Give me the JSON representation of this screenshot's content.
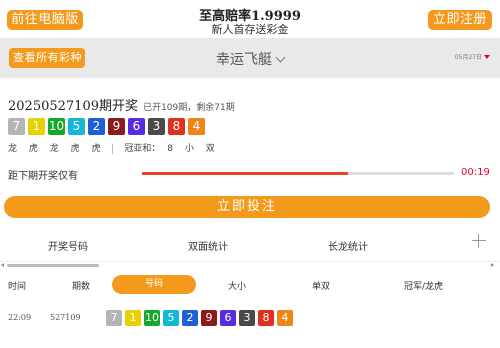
{
  "header": {
    "pc_button": "前往电脑版",
    "promo_title": "至高赔率1.9999",
    "promo_sub": "新人首存送彩金",
    "register_button": "立即注册"
  },
  "lottery_bar": {
    "all_button": "查看所有彩种",
    "name": "幸运飞艇",
    "date": "05月27日"
  },
  "draw": {
    "issue_title": "20250527109期开奖",
    "progress_text": "已开109期，剩余71期",
    "numbers": [
      "7",
      "1",
      "10",
      "5",
      "2",
      "9",
      "6",
      "3",
      "8",
      "4"
    ],
    "dragon_tiger": [
      "龙",
      "虎",
      "龙",
      "虎",
      "虎"
    ],
    "sum_label": "冠亚和：",
    "sum_value": "8",
    "size": "小",
    "parity": "双"
  },
  "countdown": {
    "label": "距下期开奖仅有",
    "time": "00:19",
    "progress": 0.66
  },
  "bet_button": "立即投注",
  "tabs": [
    "开奖号码",
    "双面统计",
    "长龙统计"
  ],
  "columns": {
    "time": "时间",
    "issue": "期数",
    "numbers": "号码",
    "size": "大小",
    "parity": "单双",
    "champion": "冠军/龙虎"
  },
  "rows": [
    {
      "time": "22:09",
      "issue": "527109",
      "numbers": [
        "7",
        "1",
        "10",
        "5",
        "2",
        "9",
        "6",
        "3",
        "8",
        "4"
      ]
    }
  ],
  "ball_colors": {
    "1": "#e8d100",
    "2": "#1e5fd8",
    "3": "#4a4a4a",
    "4": "#f08418",
    "5": "#14b8d6",
    "6": "#5a2ce0",
    "7": "#b4b4b4",
    "8": "#e0301e",
    "9": "#8c1c1c",
    "10": "#16a82a"
  }
}
